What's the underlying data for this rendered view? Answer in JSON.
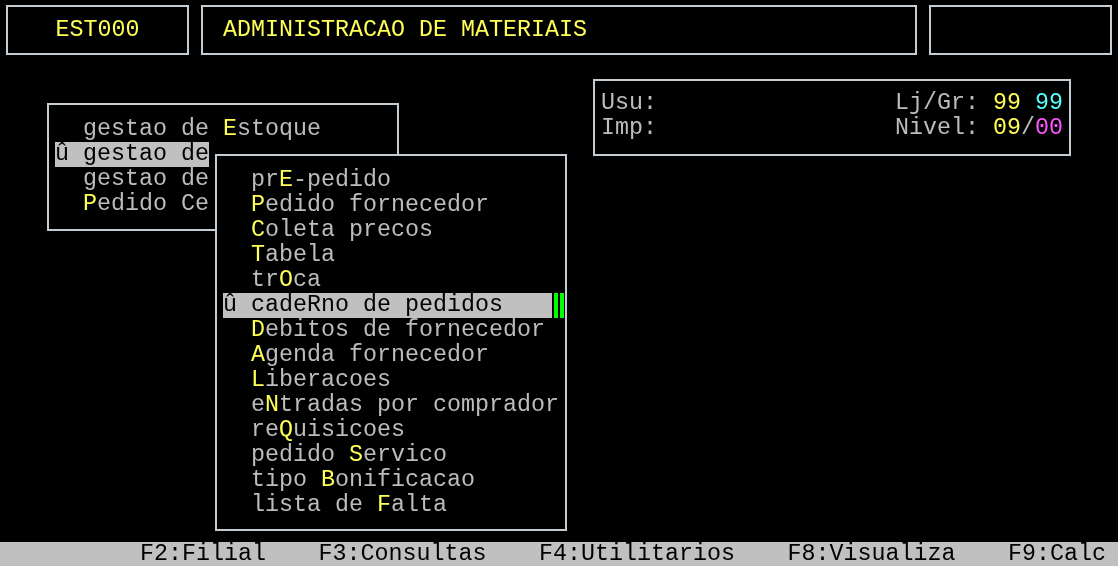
{
  "header": {
    "program_code": "EST000",
    "title": "ADMINISTRACAO DE MATERIAIS"
  },
  "session": {
    "user_label": "Usu:",
    "printer_label": "Imp:",
    "store_group": {
      "label": "Lj/Gr:",
      "values": [
        {
          "text": "99",
          "color": "#ffff55"
        },
        {
          "text": "99",
          "color": "#55ffff"
        }
      ]
    },
    "level": {
      "label": "Nivel:",
      "separator": "/",
      "values": [
        {
          "text": "09",
          "color": "#ffff55"
        },
        {
          "text": "00",
          "color": "#ff55ff"
        }
      ]
    }
  },
  "main_menu": {
    "items": [
      {
        "label": "gestao de **E**stoque",
        "selected": false
      },
      {
        "label": "gestao de",
        "selected": true,
        "marker": "û"
      },
      {
        "label": "gestao de",
        "selected": false
      },
      {
        "label": "**P**edido Ce",
        "selected": false
      }
    ]
  },
  "submenu": {
    "items": [
      {
        "label": "pr**E**-pedido",
        "selected": false
      },
      {
        "label": "**P**edido fornecedor",
        "selected": false
      },
      {
        "label": "**C**oleta precos",
        "selected": false
      },
      {
        "label": "**T**abela",
        "selected": false
      },
      {
        "label": "tr**O**ca",
        "selected": false
      },
      {
        "label": "cadeRno de pedidos",
        "selected": true,
        "marker": "û"
      },
      {
        "label": "**D**ebitos de fornecedor",
        "selected": false
      },
      {
        "label": "**A**genda fornecedor",
        "selected": false
      },
      {
        "label": "**L**iberacoes",
        "selected": false
      },
      {
        "label": "e**N**tradas por comprador",
        "selected": false
      },
      {
        "label": "re**Q**uisicoes",
        "selected": false
      },
      {
        "label": "pedido **S**ervico",
        "selected": false
      },
      {
        "label": "tipo **B**onificacao",
        "selected": false
      },
      {
        "label": "lista de **F**alta",
        "selected": false
      }
    ]
  },
  "status_bar": {
    "keys": [
      "F2:Filial",
      "F3:Consultas",
      "F4:Utilitarios",
      "F8:Visualiza",
      "F9:Calc"
    ]
  }
}
